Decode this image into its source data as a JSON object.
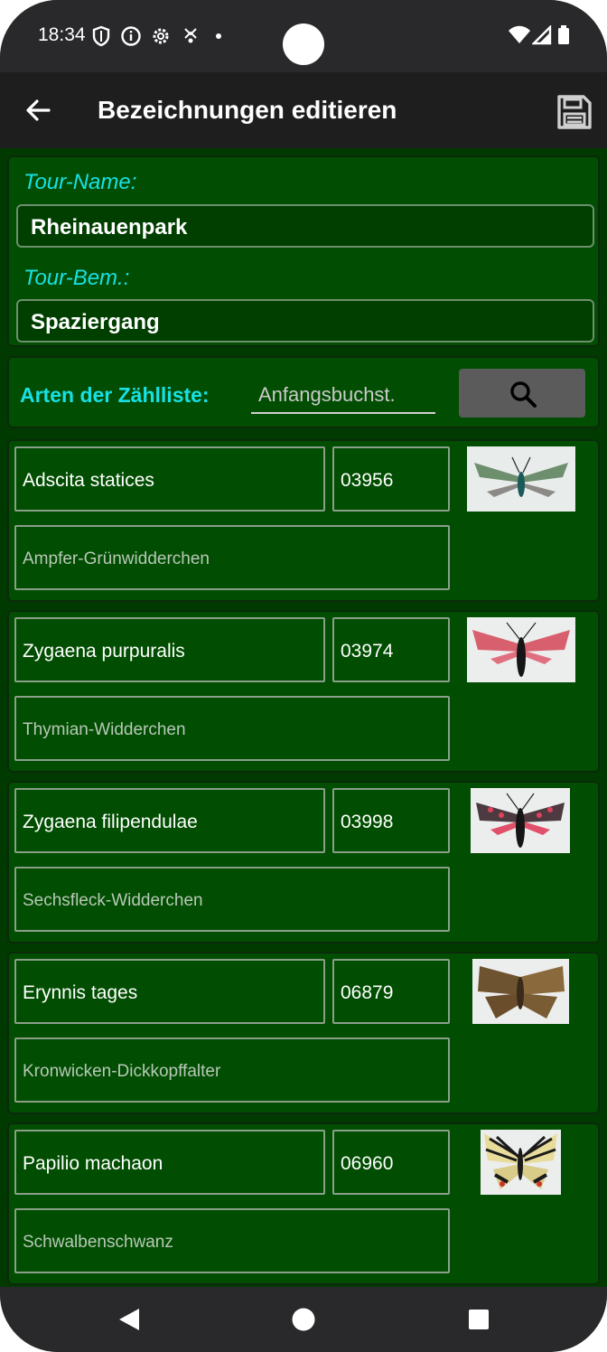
{
  "status_bar": {
    "time": "18:34",
    "icons": [
      "shield-icon",
      "info-icon",
      "settings-icon",
      "location-icon",
      "dot-icon"
    ],
    "right_icons": [
      "wifi-icon",
      "signal-icon",
      "battery-icon"
    ]
  },
  "app_bar": {
    "title": "Bezeichnungen editieren",
    "back_icon": "arrow-left-icon",
    "save_icon": "floppy-disk-icon"
  },
  "tour": {
    "name_label": "Tour-Name:",
    "name_value": "Rheinauenpark",
    "remark_label": "Tour-Bem.:",
    "remark_value": "Spaziergang"
  },
  "filter": {
    "label": "Arten der Zählliste:",
    "placeholder": "Anfangsbuchst.",
    "search_icon": "search-icon"
  },
  "species": [
    {
      "scientific": "Adscita statices",
      "code": "03956",
      "common": "Ampfer-Grünwidderchen"
    },
    {
      "scientific": "Zygaena purpuralis",
      "code": "03974",
      "common": "Thymian-Widderchen"
    },
    {
      "scientific": "Zygaena filipendulae",
      "code": "03998",
      "common": "Sechsfleck-Widderchen"
    },
    {
      "scientific": "Erynnis tages",
      "code": "06879",
      "common": "Kronwicken-Dickkopffalter"
    },
    {
      "scientific": "Papilio machaon",
      "code": "06960",
      "common": "Schwalbenschwanz"
    }
  ],
  "nav_bar": [
    "back-triangle-icon",
    "home-circle-icon",
    "recents-square-icon"
  ],
  "colors": {
    "background": "#013a01",
    "accent_label": "#17e1e5",
    "app_bar": "#1e1e1e"
  }
}
